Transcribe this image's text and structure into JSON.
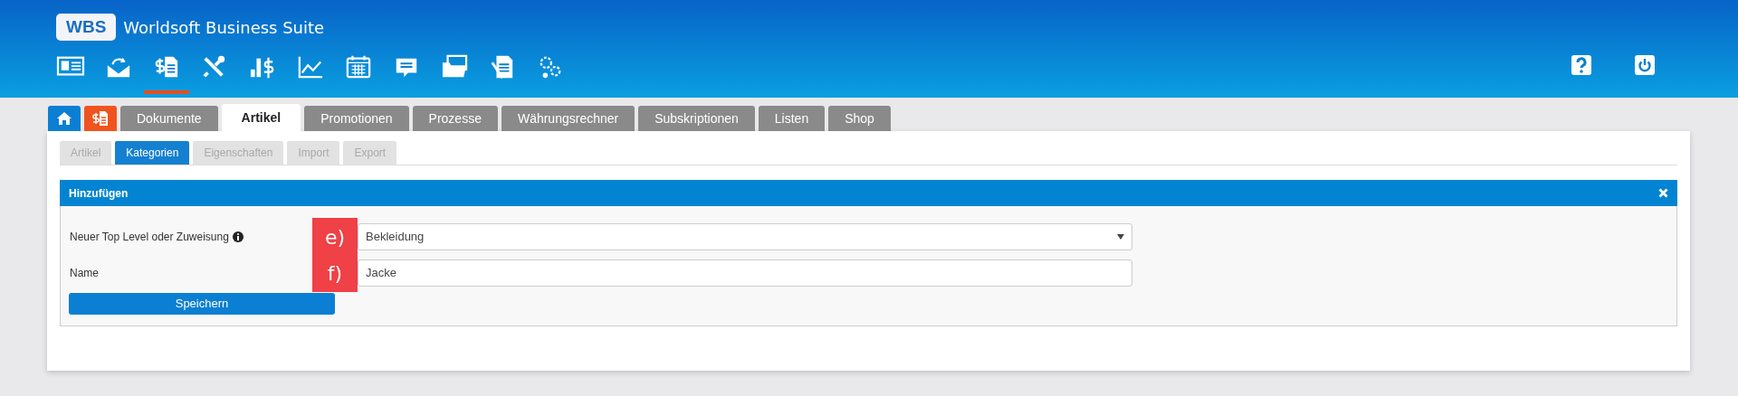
{
  "app": {
    "logo": "WBS",
    "title": "Worldsoft Business Suite"
  },
  "toolbar": [
    {
      "selected": false
    },
    {
      "selected": false
    },
    {
      "selected": true
    },
    {
      "selected": false
    },
    {
      "selected": false
    },
    {
      "selected": false
    },
    {
      "selected": false
    },
    {
      "selected": false
    },
    {
      "selected": false
    },
    {
      "selected": false
    },
    {
      "selected": false
    }
  ],
  "main_tabs": [
    {
      "label": "Dokumente",
      "selected": false
    },
    {
      "label": "Artikel",
      "selected": true
    },
    {
      "label": "Promotionen",
      "selected": false
    },
    {
      "label": "Prozesse",
      "selected": false
    },
    {
      "label": "Währungsrechner",
      "selected": false
    },
    {
      "label": "Subskriptionen",
      "selected": false
    },
    {
      "label": "Listen",
      "selected": false
    },
    {
      "label": "Shop",
      "selected": false
    }
  ],
  "sub_tabs": [
    {
      "label": "Artikel",
      "selected": false
    },
    {
      "label": "Kategorien",
      "selected": true
    },
    {
      "label": "Eigenschaften",
      "selected": false
    },
    {
      "label": "Import",
      "selected": false
    },
    {
      "label": "Export",
      "selected": false
    }
  ],
  "panel": {
    "title": "Hinzufügen",
    "fields": [
      {
        "kind": "select",
        "label": "Neuer Top Level oder Zuweisung",
        "info": true,
        "callout": "e)",
        "value": "Bekleidung"
      },
      {
        "kind": "text",
        "label": "Name",
        "info": false,
        "callout": "f)",
        "value": "Jacke"
      }
    ],
    "save_button": "Speichern"
  }
}
